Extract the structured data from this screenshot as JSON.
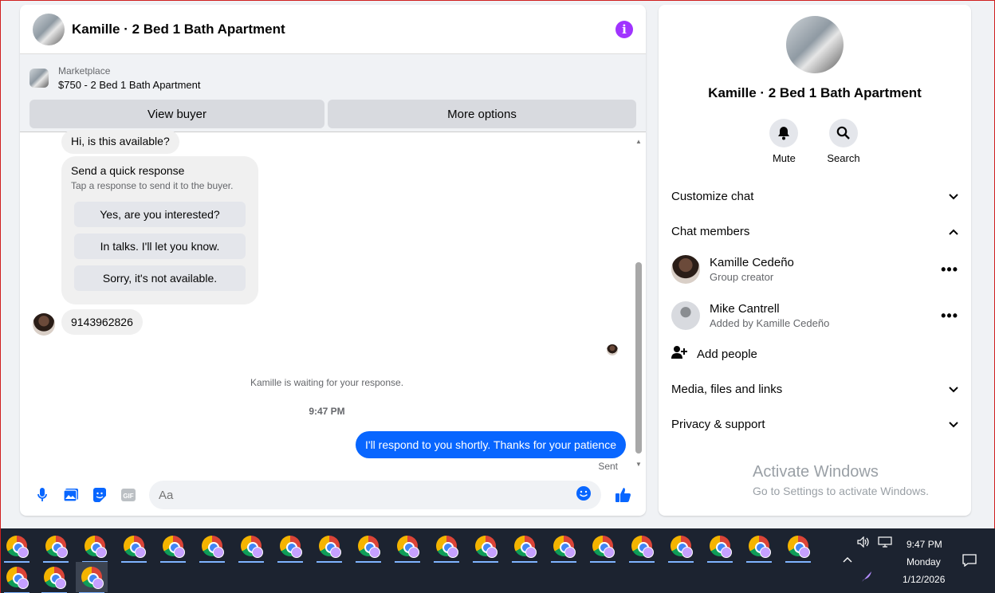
{
  "chat": {
    "title": "Kamille · 2 Bed 1 Bath Apartment",
    "marketplace_label": "Marketplace",
    "listing": "$750 - 2 Bed 1 Bath Apartment",
    "view_buyer": "View buyer",
    "more_options": "More options",
    "messages": {
      "first": "Hi, is this available?",
      "quick_title": "Send a quick response",
      "quick_sub": "Tap a response to send it to the buyer.",
      "quick_options": [
        "Yes, are you interested?",
        "In talks. I'll let you know.",
        "Sorry, it's not available."
      ],
      "phone": "9143962826",
      "waiting": "Kamille is waiting for your response.",
      "time": "9:47 PM",
      "outgoing": "I'll respond to you shortly. Thanks for your patience",
      "sent": "Sent"
    },
    "composer_placeholder": "Aa"
  },
  "info": {
    "name": "Kamille · 2 Bed 1 Bath Apartment",
    "mute": "Mute",
    "search": "Search",
    "customize": "Customize chat",
    "members_header": "Chat members",
    "members": [
      {
        "name": "Kamille Cedeño",
        "sub": "Group creator"
      },
      {
        "name": "Mike Cantrell",
        "sub": "Added by Kamille Cedeño"
      }
    ],
    "add_people": "Add people",
    "media": "Media, files and links",
    "privacy": "Privacy & support",
    "activate1": "Activate Windows",
    "activate2": "Go to Settings to activate Windows."
  },
  "taskbar": {
    "time": "9:47 PM",
    "day": "Monday",
    "date": "1/12/2026"
  },
  "colors": {
    "accent": "#0866ff",
    "info": "#a033ff",
    "taskbar": "#1c2330"
  }
}
